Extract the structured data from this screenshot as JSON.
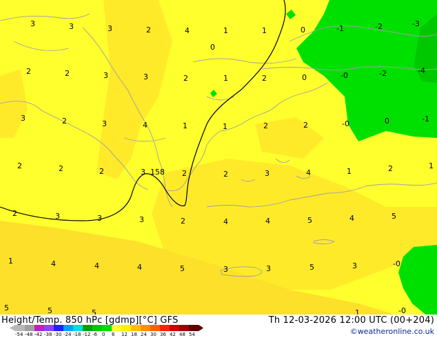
{
  "map": {
    "title": "Height/Temp. 850 hPc [gdmp][°C] GFS",
    "valid_time": "Th 12-03-2026 12:00 UTC (00+204)",
    "credit": "©weatheronline.co.uk",
    "contour_label": "158",
    "colors": {
      "yellow_light": "#ffff2e",
      "yellow_warm": "#ffea2a",
      "yellow_dark": "#fde02a",
      "green": "#00e000",
      "coast_line": "#a0a0a0",
      "contour_line": "#000000"
    },
    "color_scale": {
      "labels": [
        "-54",
        "-48",
        "-42",
        "-38",
        "-30",
        "-24",
        "-18",
        "-12",
        "-6",
        "0",
        "6",
        "12",
        "18",
        "24",
        "30",
        "36",
        "42",
        "48",
        "54"
      ],
      "colors": [
        "#b8b8b8",
        "#a0a0a0",
        "#c020c0",
        "#9040ff",
        "#2020ff",
        "#00a0ff",
        "#00e0e0",
        "#00a000",
        "#00c800",
        "#00e000",
        "#ffff2e",
        "#fff000",
        "#ffc000",
        "#ff9000",
        "#ff6000",
        "#ff2000",
        "#d00000",
        "#a00000",
        "#600000"
      ]
    },
    "values": [
      "3",
      "3",
      "3",
      "2",
      "4",
      "1",
      "1",
      "0",
      "-1",
      "-2",
      "-3",
      "0",
      "2",
      "2",
      "3",
      "3",
      "2",
      "1",
      "2",
      "0",
      "-0",
      "-2",
      "-4",
      "3",
      "2",
      "3",
      "4",
      "1",
      "1",
      "2",
      "2",
      "-0",
      "0",
      "-1",
      "2",
      "2",
      "2",
      "3",
      "2",
      "2",
      "3",
      "4",
      "1",
      "2",
      "1",
      "2",
      "3",
      "3",
      "3",
      "2",
      "4",
      "4",
      "5",
      "4",
      "5",
      "1",
      "4",
      "4",
      "4",
      "5",
      "3",
      "3",
      "5",
      "3",
      "-0",
      "5",
      "5",
      "5",
      "1",
      "-0"
    ]
  }
}
